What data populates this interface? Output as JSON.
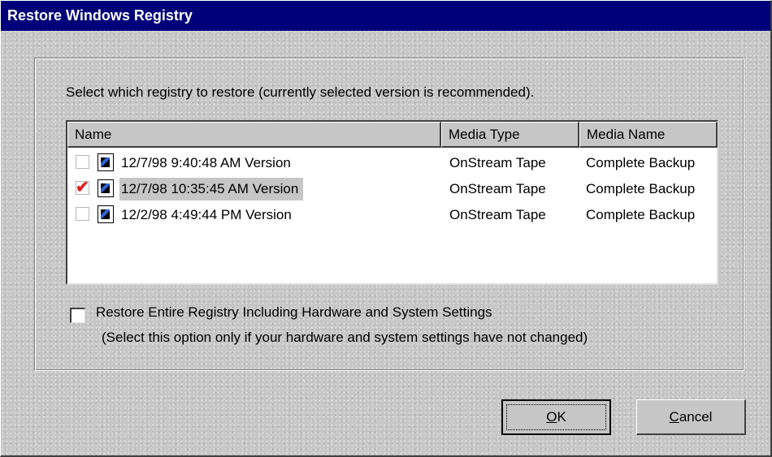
{
  "window": {
    "title": "Restore Windows Registry"
  },
  "instruction": "Select which registry to restore (currently selected version is recommended).",
  "list": {
    "columns": [
      "Name",
      "Media Type",
      "Media Name"
    ],
    "rows": [
      {
        "checked": false,
        "name": "12/7/98 9:40:48 AM Version",
        "media_type": "OnStream Tape",
        "media_name": "Complete Backup"
      },
      {
        "checked": true,
        "name": "12/7/98 10:35:45 AM Version",
        "media_type": "OnStream Tape",
        "media_name": "Complete Backup"
      },
      {
        "checked": false,
        "name": "12/2/98 4:49:44 PM Version",
        "media_type": "OnStream Tape",
        "media_name": "Complete Backup"
      }
    ]
  },
  "option": {
    "checked": false,
    "label": "Restore Entire Registry Including Hardware and System Settings",
    "note": "(Select this option only if your hardware and system settings have not changed)"
  },
  "buttons": {
    "ok": "OK",
    "cancel": "Cancel"
  },
  "colors": {
    "titlebar": "#00007b",
    "check_mark": "#e02020",
    "face": "#c6c6c6"
  },
  "icons": {
    "row_icon": "registry-icon",
    "check_mark": "check-mark-icon"
  }
}
